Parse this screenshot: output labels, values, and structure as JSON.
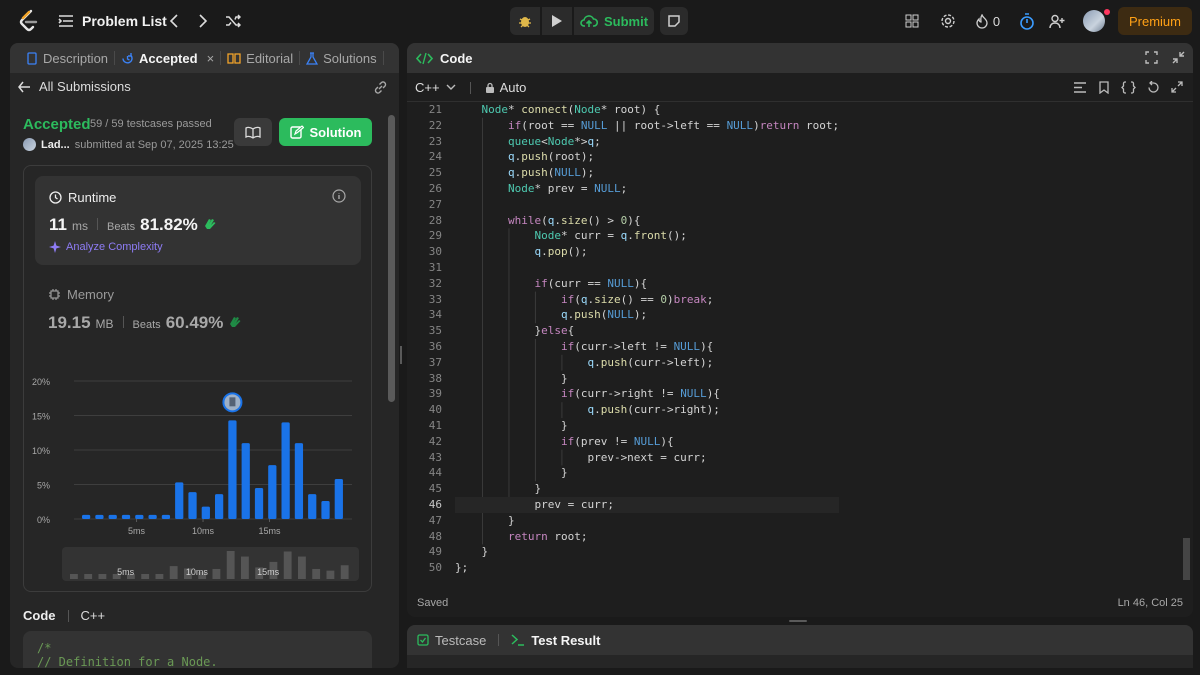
{
  "topnav": {
    "problem_list": "Problem List",
    "submit": "Submit",
    "streak": "0",
    "premium": "Premium"
  },
  "left": {
    "tabs": [
      {
        "label": "Description",
        "active": false
      },
      {
        "label": "Accepted",
        "active": true
      },
      {
        "label": "Editorial",
        "active": false
      },
      {
        "label": "Solutions",
        "active": false
      }
    ],
    "all_submissions": "All Submissions",
    "status": "Accepted",
    "testcases": "59 / 59 testcases passed",
    "user": "Lad...",
    "submitted_at": "submitted at Sep 07, 2025 13:25",
    "solution_button": "Solution",
    "runtime": {
      "label": "Runtime",
      "value": "11",
      "unit": "ms",
      "beats_label": "Beats",
      "beats": "81.82%",
      "analyze": "Analyze Complexity"
    },
    "memory": {
      "label": "Memory",
      "value": "19.15",
      "unit": "MB",
      "beats_label": "Beats",
      "beats": "60.49%"
    },
    "code_label": "Code",
    "code_lang": "C++",
    "code_preview": [
      "/*",
      "// Definition for a Node."
    ]
  },
  "chart_data": {
    "type": "bar",
    "title": "",
    "xlabel": "",
    "ylabel": "",
    "yticks": [
      "20%",
      "15%",
      "10%",
      "5%",
      "0%"
    ],
    "ylim": [
      0,
      20
    ],
    "xticks": [
      "5ms",
      "10ms",
      "15ms"
    ],
    "values": [
      0.6,
      0.6,
      0.6,
      0.6,
      0.6,
      0.6,
      0.6,
      5.3,
      3.9,
      1.8,
      3.6,
      14.3,
      11.0,
      4.5,
      7.8,
      14.0,
      11.0,
      3.6,
      2.6,
      5.8
    ],
    "highlight_index": 11,
    "bar_color": "#1a73e8",
    "grid": true
  },
  "minimap_data": {
    "values": [
      0.6,
      0.6,
      0.6,
      0.6,
      0.6,
      0.6,
      0.6,
      5.3,
      3.9,
      1.8,
      3.6,
      14.3,
      11.0,
      4.5,
      7.8,
      14.0,
      11.0,
      3.6,
      2.6,
      5.8
    ],
    "ticks": [
      "5ms",
      "10ms",
      "15ms"
    ]
  },
  "right": {
    "title": "Code",
    "language": "C++",
    "mode": "Auto",
    "status": "Saved",
    "cursor": "Ln 46, Col 25",
    "current_line": 46,
    "lines": [
      {
        "n": "21",
        "t": "    Node* connect(Node* root) {"
      },
      {
        "n": "22",
        "t": "        if(root == NULL || root->left == NULL)return root;"
      },
      {
        "n": "23",
        "t": "        queue<Node*>q;"
      },
      {
        "n": "24",
        "t": "        q.push(root);"
      },
      {
        "n": "25",
        "t": "        q.push(NULL);"
      },
      {
        "n": "26",
        "t": "        Node* prev = NULL;"
      },
      {
        "n": "27",
        "t": ""
      },
      {
        "n": "28",
        "t": "        while(q.size() > 0){"
      },
      {
        "n": "29",
        "t": "            Node* curr = q.front();"
      },
      {
        "n": "30",
        "t": "            q.pop();"
      },
      {
        "n": "31",
        "t": ""
      },
      {
        "n": "32",
        "t": "            if(curr == NULL){"
      },
      {
        "n": "33",
        "t": "                if(q.size() == 0)break;"
      },
      {
        "n": "34",
        "t": "                q.push(NULL);"
      },
      {
        "n": "35",
        "t": "            }else{"
      },
      {
        "n": "36",
        "t": "                if(curr->left != NULL){"
      },
      {
        "n": "37",
        "t": "                    q.push(curr->left);"
      },
      {
        "n": "38",
        "t": "                }"
      },
      {
        "n": "39",
        "t": "                if(curr->right != NULL){"
      },
      {
        "n": "40",
        "t": "                    q.push(curr->right);"
      },
      {
        "n": "41",
        "t": "                }"
      },
      {
        "n": "42",
        "t": "                if(prev != NULL){"
      },
      {
        "n": "43",
        "t": "                    prev->next = curr;"
      },
      {
        "n": "44",
        "t": "                }"
      },
      {
        "n": "45",
        "t": "            }"
      },
      {
        "n": "46",
        "t": "            prev = curr;"
      },
      {
        "n": "47",
        "t": "        }"
      },
      {
        "n": "48",
        "t": "        return root;"
      },
      {
        "n": "49",
        "t": "    }"
      },
      {
        "n": "50",
        "t": "};"
      }
    ]
  },
  "bottom": {
    "testcase": "Testcase",
    "test_result": "Test Result"
  }
}
